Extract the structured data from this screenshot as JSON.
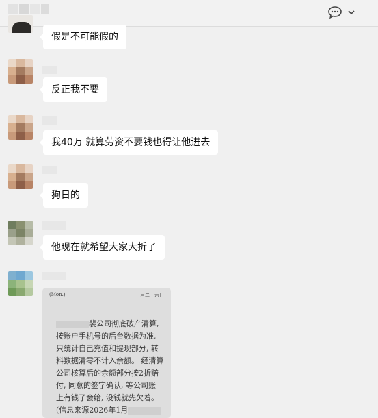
{
  "header": {
    "title_blurred": "",
    "icons": [
      "chat-bubble-icon",
      "chevron-down-icon"
    ]
  },
  "messages": [
    {
      "text": "假是不可能假的"
    },
    {
      "text": "反正我不要"
    },
    {
      "text": "我40万 就算劳资不要钱也得让他进去"
    },
    {
      "text": "狗日的"
    },
    {
      "text": "他现在就希望大家大折了"
    }
  ],
  "image_card": {
    "header_left": "(Mon.)",
    "header_right": "一月二十六日",
    "lines": [
      "裴公司彻底破产清算,",
      "按账户手机号的后台数据为准,",
      "只统计自己充值和提现部分, 转",
      "料数据清零不计入余额。 经清算",
      "公司核算后的余额部分按2折赔",
      "付, 同意的签字确认, 等公司账",
      "上有钱了会给, 没钱就先欠着。",
      "(信息来源2026年1月"
    ]
  }
}
